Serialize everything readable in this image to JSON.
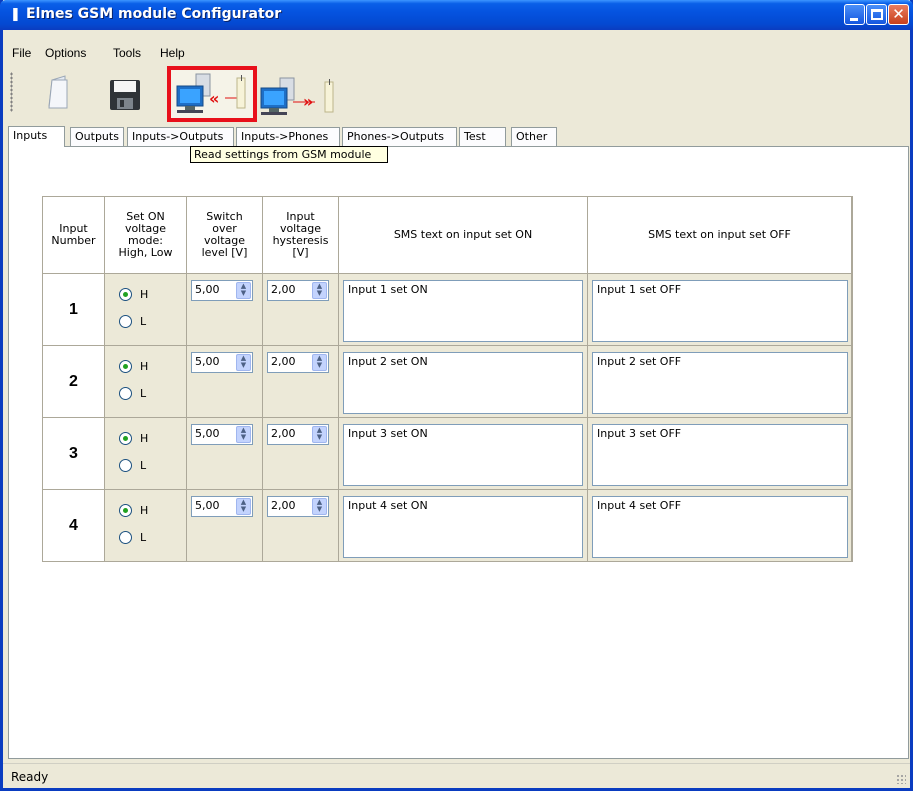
{
  "window": {
    "title": "Elmes GSM module Configurator",
    "title_color": "#0553e0"
  },
  "menu": [
    "File",
    "Options",
    "Tools",
    "Help"
  ],
  "toolbar": {
    "buttons": [
      {
        "name": "open",
        "icon": "open-document-icon"
      },
      {
        "name": "save",
        "icon": "floppy-disk-icon"
      },
      {
        "name": "read",
        "icon": "read-from-module-icon",
        "highlighted": true
      },
      {
        "name": "write",
        "icon": "write-to-module-icon"
      }
    ],
    "highlight_color": "#e8101b"
  },
  "tooltip": "Read settings from GSM module",
  "tabs": [
    "Inputs",
    "Outputs",
    "Inputs->Outputs",
    "Inputs->Phones",
    "Phones->Outputs",
    "Test",
    "Other"
  ],
  "active_tab": "Inputs",
  "table": {
    "headers": {
      "input_number": [
        "Input",
        "Number"
      ],
      "mode": [
        "Set ON",
        "voltage",
        "mode:",
        "High, Low"
      ],
      "switch": [
        "Switch",
        "over",
        "voltage",
        "level [V]"
      ],
      "hysteresis": [
        "Input",
        "voltage",
        "hysteresis",
        "[V]"
      ],
      "sms_on": "SMS text on input set ON",
      "sms_off": "SMS text on input set OFF"
    },
    "radio_h": "H",
    "radio_l": "L",
    "rows": [
      {
        "number": "1",
        "mode": "H",
        "switch_level": "5,00",
        "hysteresis": "2,00",
        "sms_on": "Input 1 set ON",
        "sms_off": "Input 1 set OFF"
      },
      {
        "number": "2",
        "mode": "H",
        "switch_level": "5,00",
        "hysteresis": "2,00",
        "sms_on": "Input 2 set ON",
        "sms_off": "Input 2 set OFF"
      },
      {
        "number": "3",
        "mode": "H",
        "switch_level": "5,00",
        "hysteresis": "2,00",
        "sms_on": "Input 3 set ON",
        "sms_off": "Input 3 set OFF"
      },
      {
        "number": "4",
        "mode": "H",
        "switch_level": "5,00",
        "hysteresis": "2,00",
        "sms_on": "Input 4 set ON",
        "sms_off": "Input 4 set OFF"
      }
    ]
  },
  "status": "Ready"
}
